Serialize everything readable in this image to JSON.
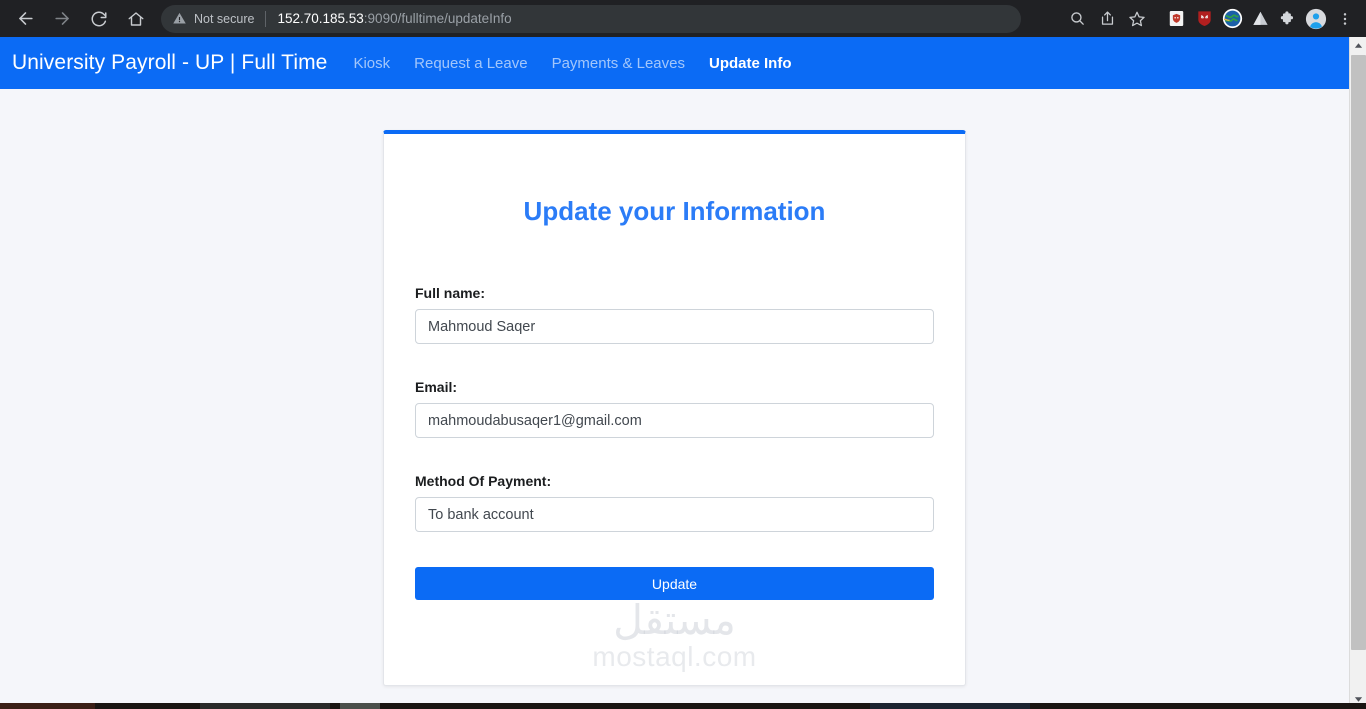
{
  "browser": {
    "back_icon": "back-arrow-icon",
    "forward_icon": "forward-arrow-icon",
    "reload_icon": "reload-icon",
    "home_icon": "home-icon",
    "security_label": "Not secure",
    "security_icon": "warning-triangle-icon",
    "url_host": "152.70.185.53",
    "url_path": ":9090/fulltime/updateInfo",
    "url_full": "152.70.185.53:9090/fulltime/updateInfo",
    "toolbar_icons": [
      "search-icon",
      "share-icon",
      "bookmark-star-icon",
      "extension-shield-icon",
      "extension-redfox-icon",
      "extension-globe-icon",
      "extension-triangle-icon",
      "extensions-puzzle-icon",
      "profile-avatar-icon",
      "chrome-menu-icon"
    ]
  },
  "navbar": {
    "brand": "University Payroll - UP | Full Time",
    "links": [
      {
        "label": "Kiosk",
        "active": false
      },
      {
        "label": "Request a Leave",
        "active": false
      },
      {
        "label": "Payments & Leaves",
        "active": false
      },
      {
        "label": "Update Info",
        "active": true
      }
    ]
  },
  "card": {
    "title": "Update your Information",
    "fields": [
      {
        "label": "Full name:",
        "value": "Mahmoud Saqer",
        "placeholder": "Full name",
        "name": "full-name"
      },
      {
        "label": "Email:",
        "value": "mahmoudabusaqer1@gmail.com",
        "placeholder": "Email",
        "name": "email"
      },
      {
        "label": "Method Of Payment:",
        "value": "To bank account",
        "placeholder": "Method of payment",
        "name": "method-of-payment"
      }
    ],
    "submit_label": "Update"
  },
  "watermark": {
    "arabic": "مستقل",
    "latin": "mostaql.com"
  },
  "colors": {
    "brand_blue": "#0b6bf5",
    "title_blue": "#2b7cf7",
    "page_bg": "#f5f6fa",
    "chrome_bg": "#202124",
    "omnibox_bg": "#323639"
  },
  "scrollbar": {
    "up_icon": "scroll-up-arrow-icon",
    "down_icon": "scroll-down-arrow-icon"
  }
}
